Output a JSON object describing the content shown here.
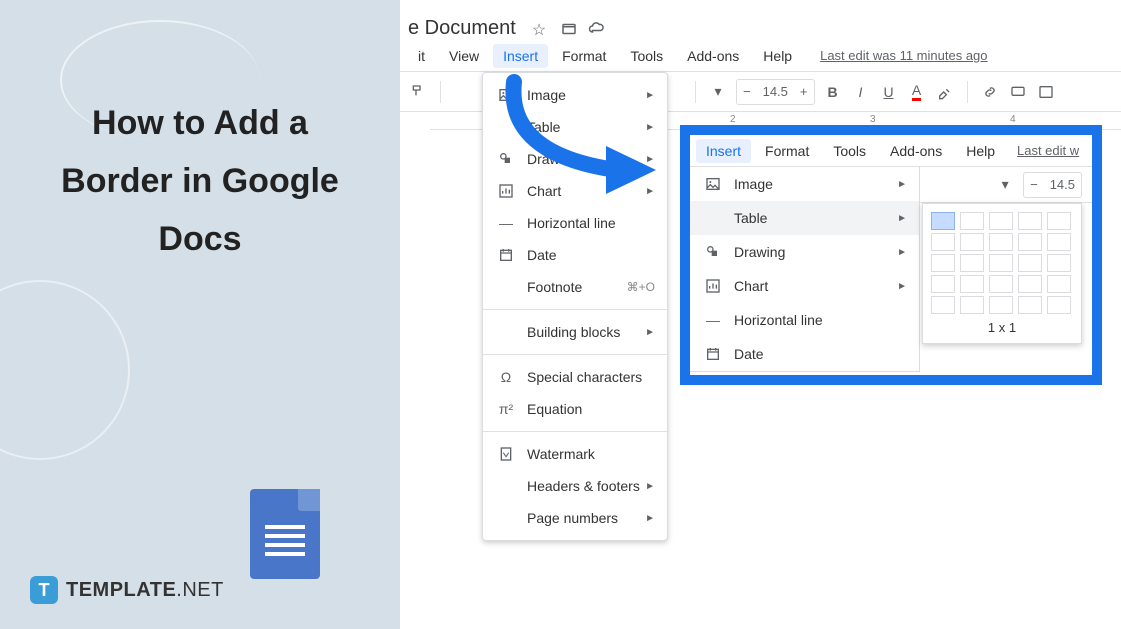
{
  "leftPanel": {
    "title": "How to Add a Border in Google Docs",
    "brand": {
      "iconLetter": "T",
      "name": "TEMPLATE",
      "suffix": ".NET"
    }
  },
  "header": {
    "docTitle": "e Document",
    "menuItems": [
      "it",
      "View",
      "Insert",
      "Format",
      "Tools",
      "Add-ons",
      "Help"
    ],
    "lastEdit": "Last edit was 11 minutes ago",
    "fontSize": "14.5"
  },
  "dropdown": {
    "items": [
      {
        "label": "Image",
        "icon": "image",
        "arrow": true
      },
      {
        "label": "Table",
        "icon": "table",
        "arrow": true
      },
      {
        "label": "Drawing",
        "icon": "drawing",
        "arrow": true
      },
      {
        "label": "Chart",
        "icon": "chart",
        "arrow": true
      },
      {
        "label": "Horizontal line",
        "icon": "hline",
        "arrow": false
      },
      {
        "label": "Date",
        "icon": "date",
        "arrow": false
      },
      {
        "label": "Footnote",
        "icon": "",
        "shortcut": "⌘+O",
        "arrow": false
      }
    ],
    "afterSep1": [
      {
        "label": "Building blocks",
        "icon": "",
        "arrow": true
      }
    ],
    "afterSep2": [
      {
        "label": "Special characters",
        "icon": "omega",
        "arrow": false
      },
      {
        "label": "Equation",
        "icon": "pi",
        "arrow": false
      }
    ],
    "afterSep3": [
      {
        "label": "Watermark",
        "icon": "watermark",
        "arrow": false
      },
      {
        "label": "Headers & footers",
        "icon": "",
        "arrow": true
      },
      {
        "label": "Page numbers",
        "icon": "",
        "arrow": true
      }
    ]
  },
  "callout": {
    "menuItems": [
      "Insert",
      "Format",
      "Tools",
      "Add-ons",
      "Help"
    ],
    "lastEdit": "Last edit w",
    "fontSize": "14.5",
    "ddItems": [
      {
        "label": "Image",
        "icon": "image",
        "arrow": true
      },
      {
        "label": "Table",
        "icon": "table",
        "arrow": true,
        "highlighted": true
      },
      {
        "label": "Drawing",
        "icon": "drawing",
        "arrow": true
      },
      {
        "label": "Chart",
        "icon": "chart",
        "arrow": true
      },
      {
        "label": "Horizontal line",
        "icon": "hline",
        "arrow": false
      },
      {
        "label": "Date",
        "icon": "date",
        "arrow": false
      }
    ],
    "tableSize": "1 x 1"
  },
  "ruler": {
    "marks": [
      "2",
      "3",
      "4"
    ]
  }
}
